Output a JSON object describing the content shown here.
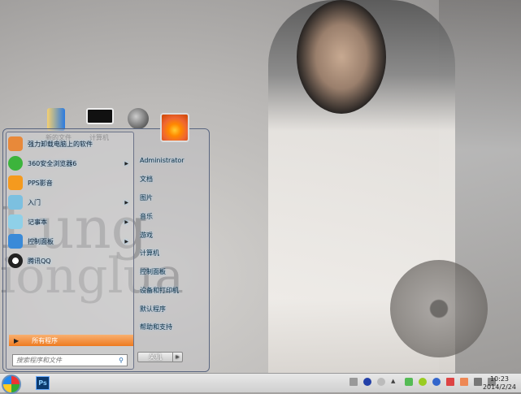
{
  "wallpaper": {
    "text1": "Lung",
    "text2": "ionglua"
  },
  "desktop": {
    "icons": [
      {
        "label": "新的文件",
        "icon": "folder-icon"
      },
      {
        "label": "计算机",
        "icon": "computer-icon"
      },
      {
        "label": "",
        "icon": "globe-icon"
      }
    ]
  },
  "start_menu": {
    "programs": [
      {
        "label": "强力卸载电脑上的软件",
        "icon": "uninstall-icon",
        "color": "#e8893a",
        "submenu": false
      },
      {
        "label": "360安全浏览器6",
        "icon": "360-browser-icon",
        "color": "#3cb43c",
        "submenu": true
      },
      {
        "label": "PPS影音",
        "icon": "pps-icon",
        "color": "#f59a1e",
        "submenu": false
      },
      {
        "label": "入门",
        "icon": "getting-started-icon",
        "color": "#7cc0e0",
        "submenu": true
      },
      {
        "label": "记事本",
        "icon": "notepad-icon",
        "color": "#8fd0e8",
        "submenu": true
      },
      {
        "label": "控制面板",
        "icon": "control-panel-icon",
        "color": "#3a8ad8",
        "submenu": true
      },
      {
        "label": "腾讯QQ",
        "icon": "qq-icon",
        "color": "#222222",
        "submenu": false
      }
    ],
    "all_programs": "所有程序",
    "search_placeholder": "搜索程序和文件",
    "right_items": [
      "Administrator",
      "文档",
      "图片",
      "音乐",
      "游戏",
      "计算机",
      "控制面板",
      "设备和打印机",
      "默认程序",
      "帮助和支持"
    ],
    "shutdown": "关机"
  },
  "taskbar": {
    "pinned": [
      {
        "label": "Ps",
        "icon": "photoshop-icon"
      }
    ],
    "time": "10:23",
    "date": "2014/2/24"
  }
}
